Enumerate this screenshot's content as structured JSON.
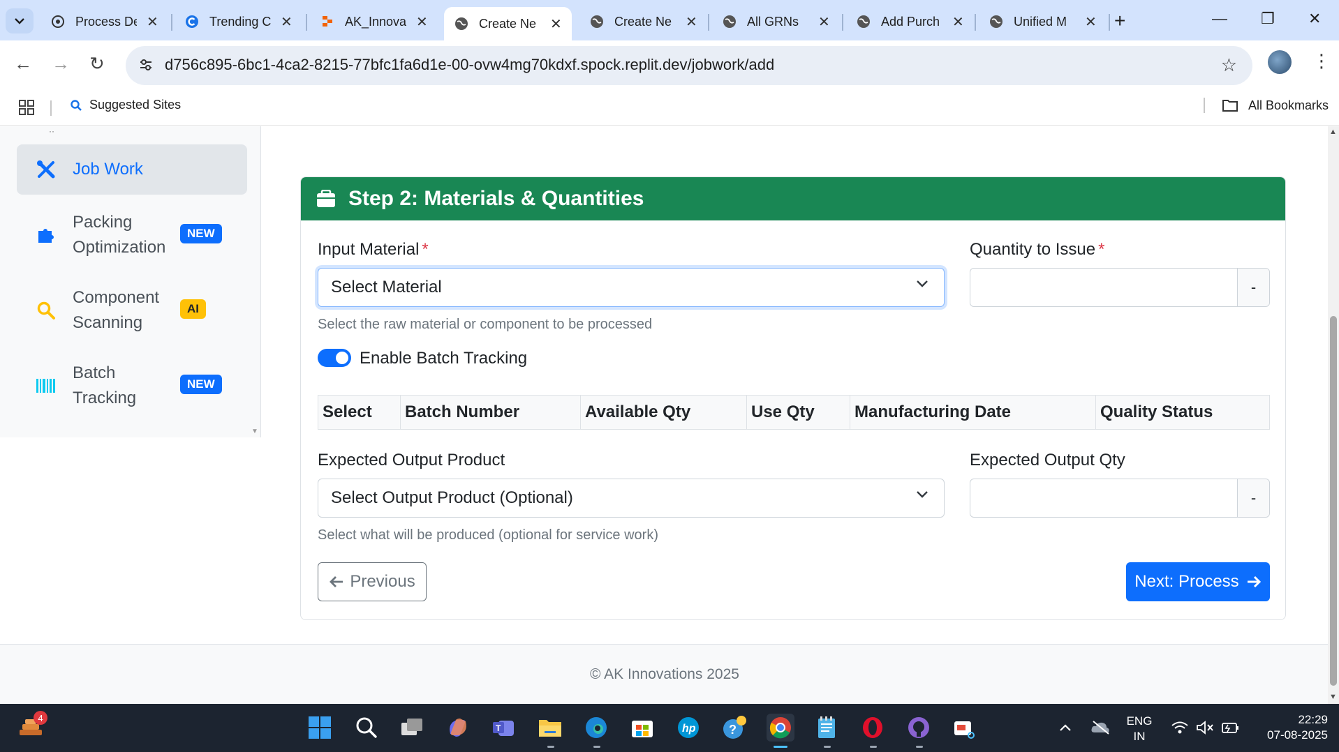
{
  "browser": {
    "tabs": [
      {
        "label": "Process De",
        "icon": "openai-icon"
      },
      {
        "label": "Trending C",
        "icon": "c-icon"
      },
      {
        "label": "AK_Innova",
        "icon": "replit-icon"
      },
      {
        "label": "Create Ne",
        "icon": "globe-icon",
        "active": true
      },
      {
        "label": "Create Ne",
        "icon": "globe-icon"
      },
      {
        "label": "All GRNs",
        "icon": "globe-icon"
      },
      {
        "label": "Add Purch",
        "icon": "globe-icon"
      },
      {
        "label": "Unified M",
        "icon": "globe-icon"
      }
    ],
    "url": "d756c895-6bc1-4ca2-8215-77bfc1fa6d1e-00-ovw4mg70kdxf.spock.replit.dev/jobwork/add",
    "bookmarks": {
      "suggested": "Suggested Sites",
      "all": "All Bookmarks"
    }
  },
  "sidebar": {
    "items": [
      {
        "label": "Job Work",
        "icon": "tools-icon",
        "active": true
      },
      {
        "label": "Packing Optimization",
        "icon": "puzzle-icon",
        "badge": "NEW"
      },
      {
        "label": "Component Scanning",
        "icon": "search-icon",
        "badge": "AI"
      },
      {
        "label": "Batch Tracking",
        "icon": "barcode-icon",
        "badge": "NEW"
      }
    ]
  },
  "card": {
    "title": "Step 2: Materials & Quantities",
    "input_material": {
      "label": "Input Material",
      "required": "*",
      "value": "Select Material",
      "help": "Select the raw material or component to be processed"
    },
    "quantity": {
      "label": "Quantity to Issue",
      "required": "*",
      "unit": "-"
    },
    "batch_toggle": {
      "label": "Enable Batch Tracking",
      "on": true
    },
    "batch_table": {
      "headers": [
        "Select",
        "Batch Number",
        "Available Qty",
        "Use Qty",
        "Manufacturing Date",
        "Quality Status"
      ]
    },
    "output_product": {
      "label": "Expected Output Product",
      "value": "Select Output Product (Optional)",
      "help": "Select what will be produced (optional for service work)"
    },
    "output_qty": {
      "label": "Expected Output Qty",
      "unit": "-"
    },
    "prev_button": "Previous",
    "next_button": "Next: Process"
  },
  "footer": {
    "text": "© AK Innovations 2025"
  },
  "taskbar": {
    "notification_count": "4",
    "lang_1": "ENG",
    "lang_2": "IN",
    "time": "22:29",
    "date": "07-08-2025"
  },
  "colors": {
    "header_green": "#198754",
    "primary": "#0d6efd",
    "required": "#dc3545",
    "ai_badge": "#ffc107"
  }
}
